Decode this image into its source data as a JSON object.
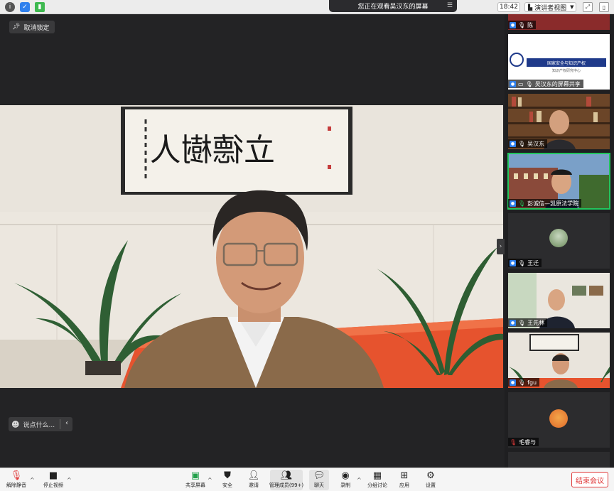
{
  "topbar": {
    "banner": "您正在观看吴汉东的屏幕",
    "time": "18:42",
    "view_label": "演讲者视图"
  },
  "stage": {
    "unlock_label": "取消锁定",
    "calligraphy": "立德樹人",
    "chat_placeholder": "说点什么..."
  },
  "gallery": [
    {
      "name": "陈",
      "partial": true
    },
    {
      "name": "吴汉东的屏幕共享",
      "slide_title": "国家安全与知识产权",
      "slide_subtitle": "知识产权研究中心"
    },
    {
      "name": "吴汉东"
    },
    {
      "name": "彭诚信—凯原法学院",
      "active": true
    },
    {
      "name": "王迁"
    },
    {
      "name": "王先林"
    },
    {
      "name": "fgu"
    },
    {
      "name": "毛睿与"
    }
  ],
  "toolbar": {
    "unmute": "解除静音",
    "stop_video": "停止视频",
    "share": "共享屏幕",
    "security": "安全",
    "invite": "邀请",
    "participants": "管理成员(99+)",
    "chat": "聊天",
    "record": "录制",
    "breakout": "分组讨论",
    "apps": "应用",
    "settings": "设置",
    "end": "结束会议"
  },
  "colors": {
    "active_speaker": "#22c55e",
    "end_button": "#e03a3a",
    "participant_icon": "#2f80ed"
  }
}
